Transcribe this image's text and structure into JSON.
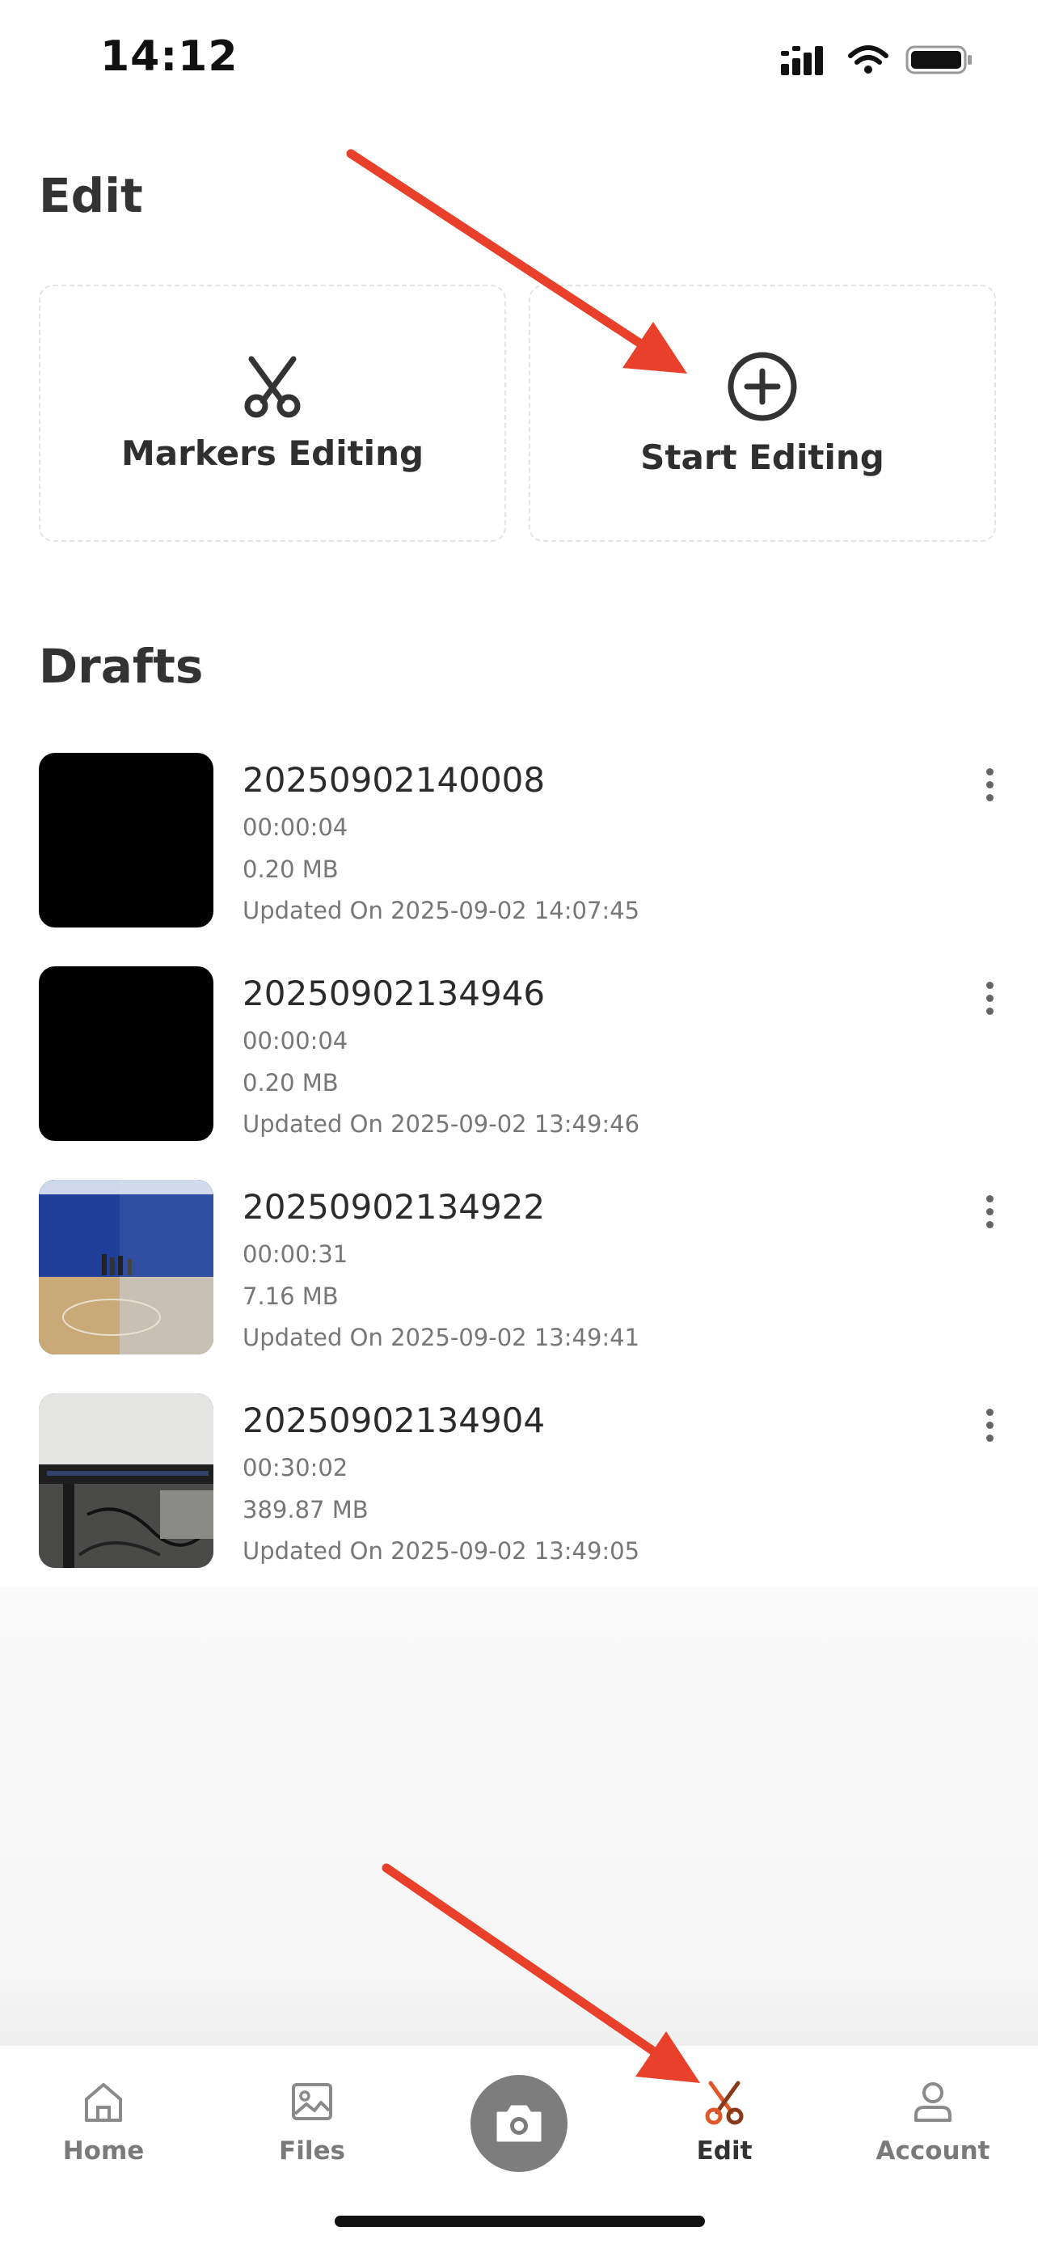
{
  "status_bar": {
    "time": "14:12"
  },
  "page": {
    "title": "Edit"
  },
  "actions": {
    "markers_label": "Markers Editing",
    "start_label": "Start Editing"
  },
  "drafts": {
    "title": "Drafts",
    "items": [
      {
        "name": "20250902140008",
        "duration": "00:00:04",
        "size": "0.20 MB",
        "updated": "Updated On 2025-09-02 14:07:45"
      },
      {
        "name": "20250902134946",
        "duration": "00:00:04",
        "size": "0.20 MB",
        "updated": "Updated On 2025-09-02 13:49:46"
      },
      {
        "name": "20250902134922",
        "duration": "00:00:31",
        "size": "7.16 MB",
        "updated": "Updated On 2025-09-02 13:49:41"
      },
      {
        "name": "20250902134904",
        "duration": "00:30:02",
        "size": "389.87 MB",
        "updated": "Updated On 2025-09-02 13:49:05"
      }
    ]
  },
  "tab_bar": {
    "home": "Home",
    "files": "Files",
    "edit": "Edit",
    "account": "Account",
    "active_color": "#e0572a"
  },
  "annotation_color": "#e8402a"
}
